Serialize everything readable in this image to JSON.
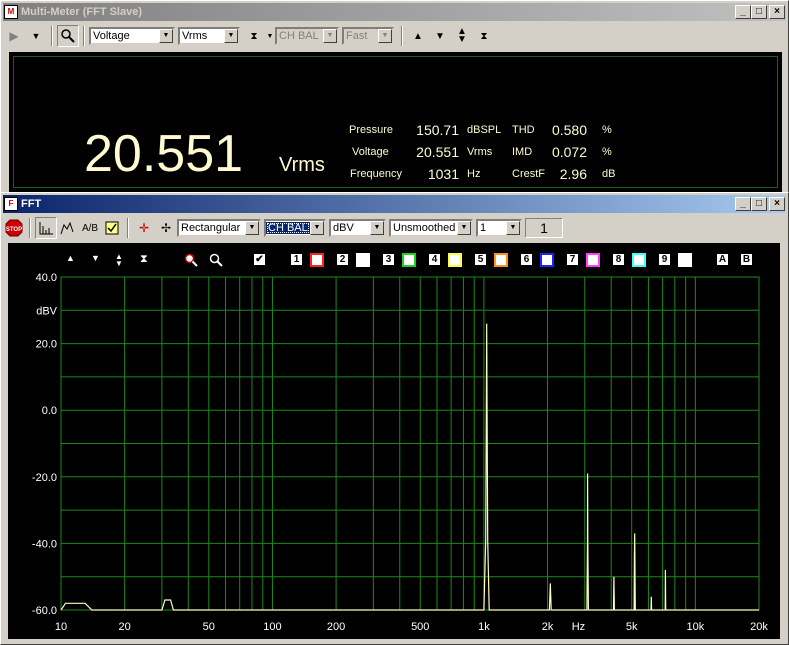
{
  "mm": {
    "title": "Multi-Meter (FFT Slave)",
    "measure_select": "Voltage",
    "unit_select": "Vrms",
    "channel_select": "CH BAL",
    "speed_select": "Fast",
    "big_value": "20.551",
    "big_unit": "Vrms",
    "readings": [
      {
        "label": "Pressure",
        "value": "150.71",
        "unit": "dBSPL"
      },
      {
        "label": "Voltage",
        "value": "20.551",
        "unit": "Vrms"
      },
      {
        "label": "Frequency",
        "value": "1031",
        "unit": "Hz"
      }
    ],
    "dist": [
      {
        "label": "THD",
        "value": "0.580",
        "unit": "%"
      },
      {
        "label": "IMD",
        "value": "0.072",
        "unit": "%"
      },
      {
        "label": "CrestF",
        "value": "2.96",
        "unit": "dB"
      }
    ]
  },
  "fft": {
    "title": "FFT",
    "window_select": "Rectangular",
    "channel_select": "CH BAL",
    "unit_select": "dBV",
    "smoothing_select": "Unsmoothed",
    "avg_select": "1",
    "avg_count": "1",
    "legend_numbers": [
      "1",
      "2",
      "3",
      "4",
      "5",
      "6",
      "7",
      "8",
      "9"
    ],
    "legend_colors": [
      "#ff2020",
      "#ffffff",
      "#20d020",
      "#ffff40",
      "#ff9020",
      "#2020ff",
      "#ff40ff",
      "#40ffff",
      "#ffffff"
    ],
    "ab": [
      "A",
      "B"
    ]
  },
  "chart_data": {
    "type": "line",
    "xscale": "log",
    "xlim": [
      10,
      20000
    ],
    "ylim": [
      -60,
      40
    ],
    "grid": true,
    "ylabel": "dBV",
    "xlabel": "Hz",
    "yticks": [
      "40.0",
      "20.0",
      "0.0",
      "-20.0",
      "-40.0",
      "-60.0"
    ],
    "ytick_values": [
      40,
      20,
      0,
      -20,
      -40,
      -60
    ],
    "xticks": [
      "10",
      "20",
      "50",
      "100",
      "200",
      "500",
      "1k",
      "2k",
      "5k",
      "10k",
      "20k"
    ],
    "xtick_values": [
      10,
      20,
      50,
      100,
      200,
      500,
      1000,
      2000,
      5000,
      10000,
      20000
    ],
    "series": [
      {
        "color": "#fffbc0",
        "points": [
          [
            10,
            -60
          ],
          [
            10.5,
            -58
          ],
          [
            13,
            -58
          ],
          [
            14,
            -60
          ],
          [
            30,
            -60
          ],
          [
            31,
            -57
          ],
          [
            33,
            -57
          ],
          [
            34,
            -60
          ],
          [
            1000,
            -60
          ],
          [
            1020,
            -39
          ],
          [
            1028,
            4
          ],
          [
            1031,
            26
          ],
          [
            1034,
            4
          ],
          [
            1042,
            -39
          ],
          [
            1060,
            -60
          ],
          [
            2040,
            -60
          ],
          [
            2060,
            -52
          ],
          [
            2080,
            -60
          ],
          [
            3070,
            -60
          ],
          [
            3090,
            -39
          ],
          [
            3095,
            -19
          ],
          [
            3100,
            -39
          ],
          [
            3120,
            -60
          ],
          [
            4100,
            -60
          ],
          [
            4120,
            -50
          ],
          [
            4140,
            -60
          ],
          [
            5130,
            -60
          ],
          [
            5150,
            -44
          ],
          [
            5165,
            -37
          ],
          [
            5180,
            -44
          ],
          [
            5200,
            -60
          ],
          [
            6170,
            -60
          ],
          [
            6190,
            -56
          ],
          [
            6210,
            -60
          ],
          [
            7200,
            -60
          ],
          [
            7210,
            -54
          ],
          [
            7220,
            -48
          ],
          [
            7240,
            -60
          ],
          [
            20000,
            -60
          ]
        ]
      }
    ]
  }
}
